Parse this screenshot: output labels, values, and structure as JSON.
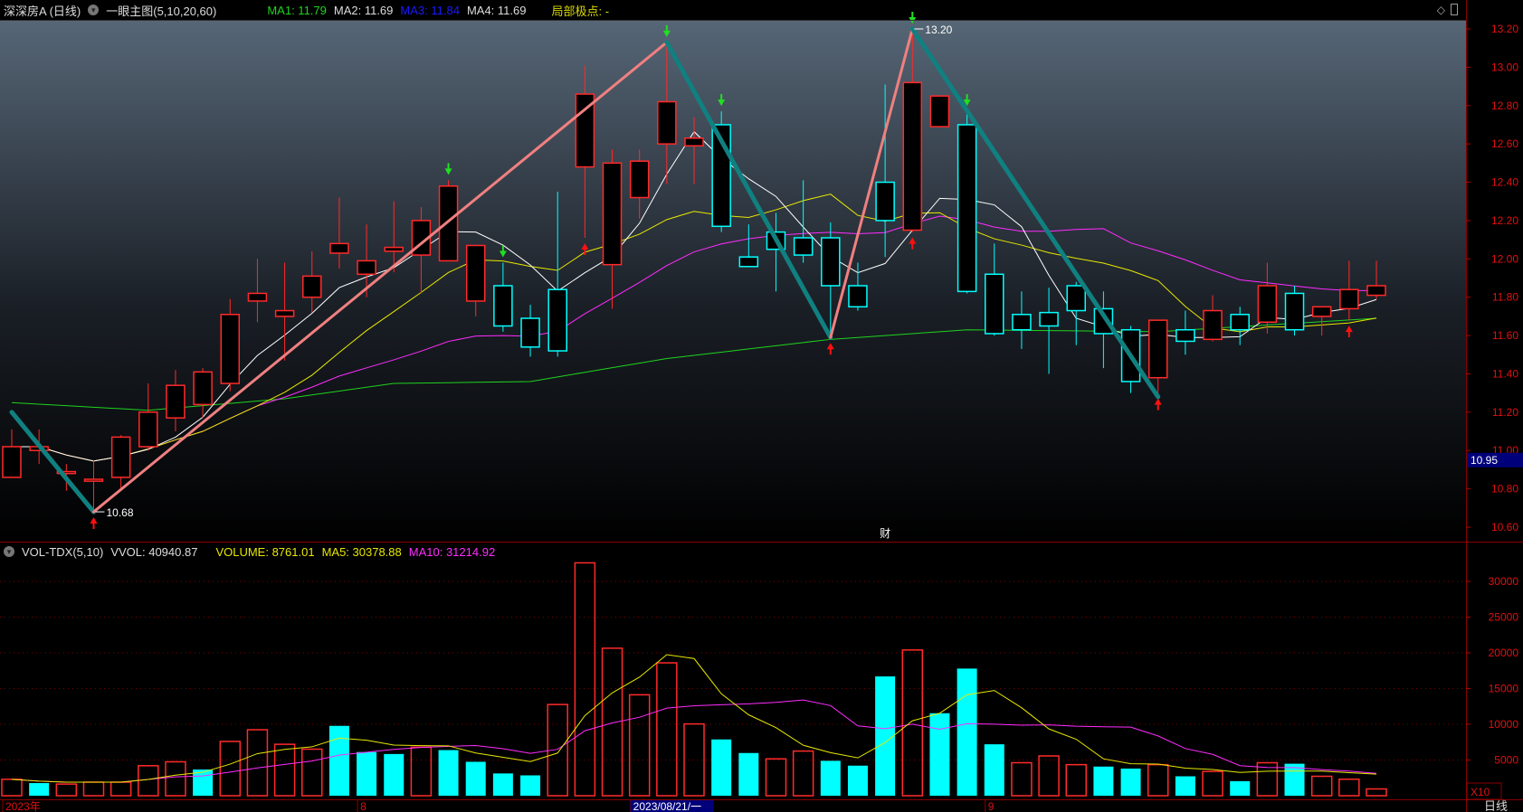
{
  "header": {
    "title": "深深房A (日线)",
    "indicator": "一眼主图(5,10,20,60)",
    "ma1": "MA1: 11.79",
    "ma2": "MA2: 11.69",
    "ma3": "MA3: 11.84",
    "ma4": "MA4: 11.69",
    "extreme": "局部极点: -",
    "icon_a": "diamond-icon",
    "icon_b": "window-icon"
  },
  "volume_header": {
    "name": "VOL-TDX(5,10)",
    "vvol": "VVOL: 40940.87",
    "volume": "VOLUME: 8761.01",
    "ma5": "MA5: 30378.88",
    "ma10": "MA10: 31214.92"
  },
  "colors": {
    "up": "#ff2a2a",
    "down": "#00ffff",
    "ma5": "#ffffff",
    "ma10": "#e8e800",
    "ma20": "#ff2cff",
    "ma60": "#1fd31f",
    "zig_up": "#f08080",
    "zig_down": "#108080",
    "axis": "#8b0000"
  },
  "chart_data": {
    "type": "candlestick",
    "price_axis": {
      "ylim": [
        10.6,
        13.2
      ],
      "ticks": [
        "13.20",
        "13.00",
        "12.80",
        "12.60",
        "12.40",
        "12.20",
        "12.00",
        "11.80",
        "11.60",
        "11.40",
        "11.20",
        "11.00",
        "10.80",
        "10.60"
      ],
      "current_label": "10.95"
    },
    "ohlc": [
      [
        10.86,
        11.11,
        10.86,
        11.02
      ],
      [
        11.0,
        11.11,
        10.93,
        11.02
      ],
      [
        10.88,
        10.93,
        10.79,
        10.89
      ],
      [
        10.84,
        10.95,
        10.68,
        10.85
      ],
      [
        10.86,
        11.08,
        10.8,
        11.07
      ],
      [
        11.02,
        11.35,
        11.0,
        11.2
      ],
      [
        11.17,
        11.42,
        11.1,
        11.34
      ],
      [
        11.24,
        11.43,
        11.17,
        11.41
      ],
      [
        11.35,
        11.79,
        11.31,
        11.71
      ],
      [
        11.78,
        12.0,
        11.67,
        11.82
      ],
      [
        11.7,
        11.98,
        11.47,
        11.73
      ],
      [
        11.8,
        12.04,
        11.72,
        11.91
      ],
      [
        12.03,
        12.32,
        11.95,
        12.08
      ],
      [
        11.92,
        12.18,
        11.8,
        11.99
      ],
      [
        12.04,
        12.3,
        11.93,
        12.06
      ],
      [
        12.02,
        12.27,
        11.82,
        12.2
      ],
      [
        11.99,
        12.41,
        11.99,
        12.38
      ],
      [
        11.78,
        12.07,
        11.7,
        12.07
      ],
      [
        11.86,
        11.98,
        11.62,
        11.65
      ],
      [
        11.69,
        11.76,
        11.49,
        11.54
      ],
      [
        11.84,
        12.35,
        11.49,
        11.52
      ],
      [
        12.48,
        13.01,
        12.11,
        12.86
      ],
      [
        11.97,
        12.57,
        11.74,
        12.5
      ],
      [
        12.32,
        12.57,
        12.21,
        12.51
      ],
      [
        12.6,
        13.13,
        12.39,
        12.82
      ],
      [
        12.59,
        12.74,
        12.39,
        12.63
      ],
      [
        12.7,
        12.77,
        12.14,
        12.17
      ],
      [
        12.01,
        12.18,
        11.96,
        11.96
      ],
      [
        12.14,
        12.24,
        11.83,
        12.05
      ],
      [
        12.11,
        12.41,
        11.98,
        12.02
      ],
      [
        12.11,
        12.19,
        11.59,
        11.86
      ],
      [
        11.86,
        11.98,
        11.73,
        11.75
      ],
      [
        12.4,
        12.91,
        12.01,
        12.2
      ],
      [
        12.15,
        13.2,
        12.14,
        12.92
      ],
      [
        12.69,
        12.85,
        12.69,
        12.85
      ],
      [
        12.7,
        12.77,
        11.82,
        11.83
      ],
      [
        11.92,
        12.08,
        11.6,
        11.61
      ],
      [
        11.71,
        11.83,
        11.53,
        11.63
      ],
      [
        11.72,
        11.85,
        11.4,
        11.65
      ],
      [
        11.86,
        11.88,
        11.55,
        11.73
      ],
      [
        11.74,
        11.83,
        11.43,
        11.61
      ],
      [
        11.63,
        11.65,
        11.3,
        11.36
      ],
      [
        11.38,
        11.68,
        11.3,
        11.68
      ],
      [
        11.63,
        11.73,
        11.5,
        11.57
      ],
      [
        11.58,
        11.81,
        11.57,
        11.73
      ],
      [
        11.71,
        11.75,
        11.55,
        11.63
      ],
      [
        11.67,
        11.98,
        11.61,
        11.86
      ],
      [
        11.82,
        11.86,
        11.6,
        11.63
      ],
      [
        11.7,
        11.75,
        11.6,
        11.75
      ],
      [
        11.74,
        11.99,
        11.68,
        11.84
      ],
      [
        11.81,
        11.99,
        11.79,
        11.86
      ]
    ],
    "ma60_points": [
      [
        0,
        11.25
      ],
      [
        5,
        11.21
      ],
      [
        10,
        11.27
      ],
      [
        14,
        11.35
      ],
      [
        19,
        11.36
      ],
      [
        24,
        11.48
      ],
      [
        30,
        11.58
      ],
      [
        35,
        11.63
      ],
      [
        42,
        11.62
      ],
      [
        50,
        11.69
      ]
    ],
    "zigzag": [
      [
        0,
        11.2
      ],
      [
        3,
        10.68
      ],
      [
        24,
        13.13
      ],
      [
        30,
        11.59
      ],
      [
        33,
        13.2
      ],
      [
        42,
        11.28
      ]
    ],
    "pivot_labels": [
      {
        "i": 3,
        "price": 10.68,
        "text": "10.68"
      },
      {
        "i": 33,
        "price": 13.2,
        "text": "13.20"
      }
    ],
    "buy_arrows": [
      3,
      21,
      30,
      33,
      42,
      49
    ],
    "sell_arrows": [
      16,
      18,
      24,
      26,
      33,
      35
    ],
    "finance_marker": {
      "i": 32,
      "text": "财"
    },
    "volume": [
      2300,
      1770,
      1630,
      1900,
      1900,
      4200,
      4750,
      3670,
      7600,
      9240,
      7200,
      6520,
      9780,
      6110,
      5840,
      6800,
      6390,
      4750,
      3120,
      2850,
      12770,
      32600,
      20650,
      14130,
      18600,
      10050,
      7880,
      5980,
      5160,
      6250,
      4890,
      4210,
      16700,
      20400,
      11550,
      17800,
      7200,
      4620,
      5570,
      4350,
      4080,
      3800,
      4350,
      2720,
      3400,
      2040,
      4620,
      4480,
      2720,
      2310,
      950
    ],
    "volume_up": [
      1,
      0,
      1,
      1,
      1,
      1,
      1,
      0,
      1,
      1,
      1,
      1,
      0,
      0,
      0,
      1,
      0,
      0,
      0,
      0,
      1,
      1,
      1,
      1,
      1,
      1,
      0,
      0,
      1,
      1,
      0,
      0,
      0,
      1,
      0,
      0,
      0,
      1,
      1,
      1,
      0,
      0,
      1,
      0,
      1,
      0,
      1,
      0,
      1,
      1,
      1
    ],
    "volume_axis": {
      "ylim": [
        0,
        33000
      ],
      "ticks": [
        "30000",
        "25000",
        "20000",
        "15000",
        "10000",
        "5000"
      ],
      "multiplier": "X10"
    },
    "date_axis": [
      {
        "i": 0,
        "text": "2023年"
      },
      {
        "i": 13,
        "text": "8"
      },
      {
        "i": 23,
        "text": "2023/08/21/一",
        "highlight": true
      },
      {
        "i": 36,
        "text": "9"
      }
    ],
    "period_label": "日线"
  }
}
